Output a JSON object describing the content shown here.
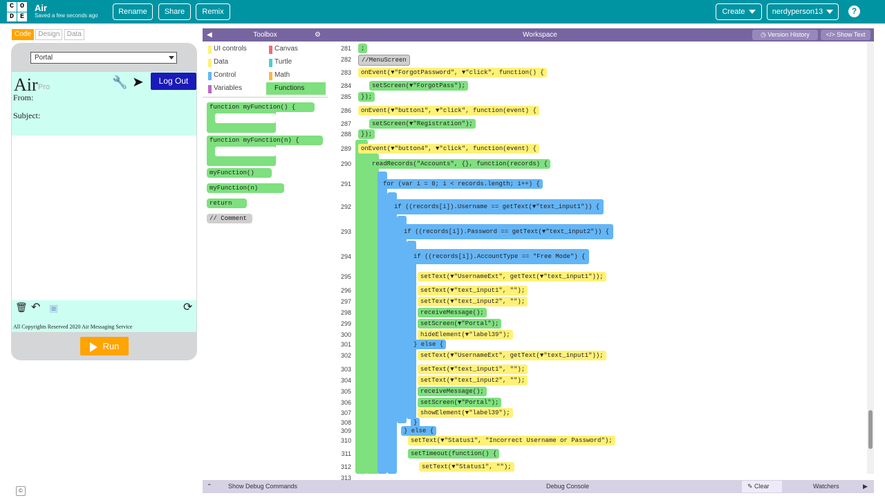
{
  "topbar": {
    "app_title": "Air",
    "save_status": "Saved a few seconds ago",
    "rename": "Rename",
    "share": "Share",
    "remix": "Remix",
    "create": "Create",
    "user": "nerdyperson13",
    "help": "?",
    "logo_letters": [
      "C",
      "O",
      "D",
      "E"
    ]
  },
  "tabs": {
    "code": "Code",
    "design": "Design",
    "data": "Data"
  },
  "app": {
    "screen_select": "Portal",
    "logo": "Air",
    "pro": "Pro",
    "logout": "Log Out",
    "from": "From:",
    "subject": "Subject:",
    "copyright": "All Copyrights Reserved 2020 Air Messaging Service",
    "run": "Run"
  },
  "toolbox": {
    "title": "Toolbox",
    "categories": [
      {
        "label": "UI controls",
        "color": "#fff176"
      },
      {
        "label": "Canvas",
        "color": "#ef6b7b"
      },
      {
        "label": "Data",
        "color": "#fff176"
      },
      {
        "label": "Turtle",
        "color": "#4dd0c7"
      },
      {
        "label": "Control",
        "color": "#64b5f6"
      },
      {
        "label": "Math",
        "color": "#ffb74d"
      },
      {
        "label": "Variables",
        "color": "#ba68c8"
      },
      {
        "label": "Functions",
        "color": "#7ee07e"
      }
    ],
    "blocks": [
      "function myFunction() {",
      "function myFunction(n) {",
      "myFunction()",
      "myFunction(n)",
      "return",
      "// Comment"
    ]
  },
  "workspace": {
    "title": "Workspace",
    "version_history": "Version History",
    "show_text": "Show Text",
    "lines": [
      {
        "n": "281",
        "t": ";"
      },
      {
        "n": "282",
        "t": "//MenuScreen"
      },
      {
        "n": "283",
        "t": "onEvent(▼\"ForgotPassword\", ▼\"click\", function() {"
      },
      {
        "n": "284",
        "t": "setScreen(▼\"ForgotPass\");"
      },
      {
        "n": "285",
        "t": "});"
      },
      {
        "n": "286",
        "t": "onEvent(▼\"button1\", ▼\"click\", function(event) {"
      },
      {
        "n": "287",
        "t": "setScreen(▼\"Registration\");"
      },
      {
        "n": "288",
        "t": "});"
      },
      {
        "n": "289",
        "t": "onEvent(▼\"button4\", ▼\"click\", function(event) {"
      },
      {
        "n": "290",
        "t": "readRecords(\"Accounts\", {}, function(records) {"
      },
      {
        "n": "291",
        "t": "for (var i = 0; i < records.length; i++) {"
      },
      {
        "n": "292",
        "t": "if ((records[i]).Username == getText(▼\"text_input1\")) {"
      },
      {
        "n": "293",
        "t": "if ((records[i]).Password == getText(▼\"text_input2\")) {"
      },
      {
        "n": "294",
        "t": "if ((records[i]).AccountType == \"Free Mode\") {"
      },
      {
        "n": "295",
        "t": "setText(▼\"UsernameExt\", getText(▼\"text_input1\"));"
      },
      {
        "n": "296",
        "t": "setText(▼\"text_input1\", \"\");"
      },
      {
        "n": "297",
        "t": "setText(▼\"text_input2\", \"\");"
      },
      {
        "n": "298",
        "t": "receiveMessage();"
      },
      {
        "n": "299",
        "t": "setScreen(▼\"Portal\");"
      },
      {
        "n": "300",
        "t": "hideElement(▼\"label39\");"
      },
      {
        "n": "301",
        "t": "} else {"
      },
      {
        "n": "302",
        "t": "setText(▼\"UsernameExt\", getText(▼\"text_input1\"));"
      },
      {
        "n": "303",
        "t": "setText(▼\"text_input1\", \"\");"
      },
      {
        "n": "304",
        "t": "setText(▼\"text_input2\", \"\");"
      },
      {
        "n": "305",
        "t": "receiveMessage();"
      },
      {
        "n": "306",
        "t": "setScreen(▼\"Portal\");"
      },
      {
        "n": "307",
        "t": "showElement(▼\"label39\");"
      },
      {
        "n": "308",
        "t": "}"
      },
      {
        "n": "309",
        "t": "} else {"
      },
      {
        "n": "310",
        "t": "setText(▼\"Status1\", \"Incorrect Username or Password\");"
      },
      {
        "n": "311",
        "t": "setTimeout(function() {"
      },
      {
        "n": "312",
        "t": "setText(▼\"Status1\", \"\");"
      },
      {
        "n": "313",
        "t": ""
      }
    ]
  },
  "bottom": {
    "debug_commands": "Show Debug Commands",
    "debug_console": "Debug Console",
    "clear": "Clear",
    "watchers": "Watchers"
  },
  "colors": {
    "topbar": "#0094a3",
    "header": "#7665a0",
    "run": "#ffa400",
    "logout": "#1a1ab8",
    "app_bg": "#ccfff2"
  }
}
